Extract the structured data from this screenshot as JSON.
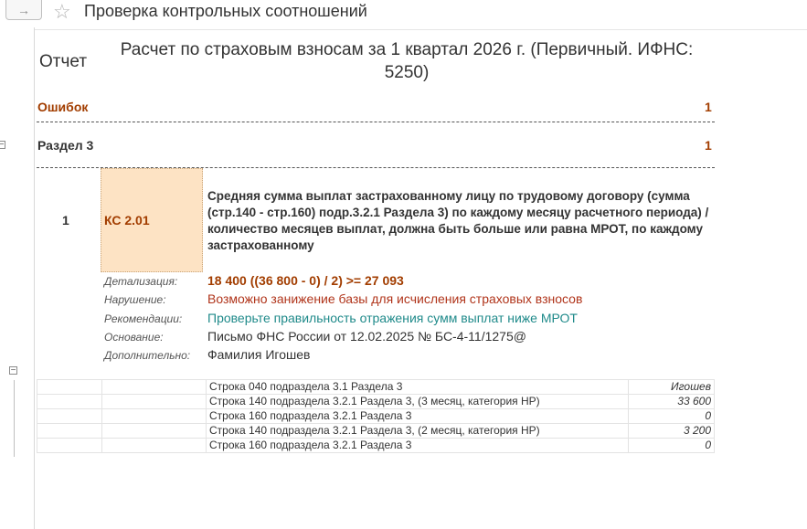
{
  "window": {
    "title": "Проверка контрольных соотношений"
  },
  "nav": {
    "forward_icon": "→"
  },
  "report": {
    "label": "Отчет",
    "title": "Расчет по страховым взносам за 1 квартал 2026 г. (Первичный. ИФНС: 5250)"
  },
  "errors": {
    "label": "Ошибок",
    "count": "1"
  },
  "section": {
    "label": "Раздел 3",
    "count": "1"
  },
  "check": {
    "number": "1",
    "code": "КС 2.01",
    "description": "Средняя сумма выплат застрахованному лицу по трудовому договору (сумма (стр.140 - стр.160) подр.3.2.1 Раздела 3) по каждому месяцу расчетного периода) / количество месяцев выплат, должна быть больше или равна МРОТ, по каждому застрахованному",
    "details": {
      "detail_label": "Детализация:",
      "detail_value": "18 400 ((36 800 - 0) / 2) >= 27 093",
      "violation_label": "Нарушение:",
      "violation_value": "Возможно занижение базы для исчисления страховых взносов",
      "recommendation_label": "Рекомендации:",
      "recommendation_value": "Проверьте правильность отражения сумм выплат ниже МРОТ",
      "basis_label": "Основание:",
      "basis_value": "Письмо ФНС России от 12.02.2025 № БС-4-11/1275@",
      "additional_label": "Дополнительно:",
      "additional_value": "Фамилия Игошев"
    }
  },
  "rows": [
    {
      "name": "Строка 040 подраздела 3.1 Раздела 3",
      "value": "Игошев"
    },
    {
      "name": "Строка 140 подраздела 3.2.1 Раздела 3, (3 месяц, категория НР)",
      "value": "33 600"
    },
    {
      "name": "Строка 160 подраздела 3.2.1 Раздела 3",
      "value": "0"
    },
    {
      "name": "Строка 140 подраздела 3.2.1 Раздела 3, (2 месяц, категория НР)",
      "value": "3 200"
    },
    {
      "name": "Строка 160 подраздела 3.2.1 Раздела 3",
      "value": "0"
    }
  ],
  "colors": {
    "accent_orange": "#a23d00",
    "violation_red": "#b0341a",
    "recommendation_teal": "#1f8a8a",
    "code_cell_bg": "#fde3c4"
  },
  "icons": {
    "favorite": "star-icon",
    "forward": "arrow-right-icon",
    "collapse": "minus-box-icon"
  }
}
